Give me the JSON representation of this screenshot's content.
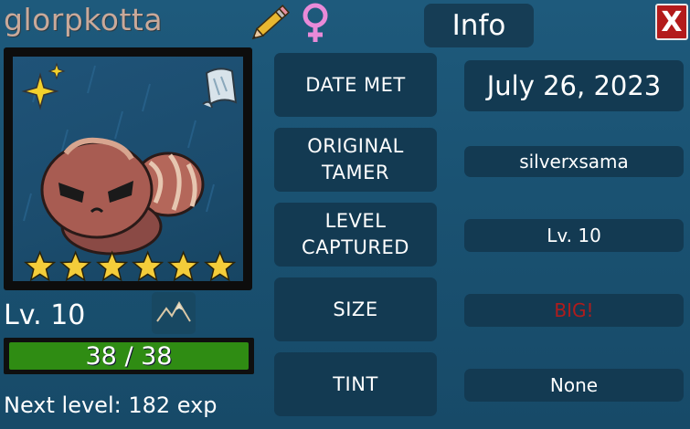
{
  "monster": {
    "name": "glorpkotta",
    "level": "Lv. 10",
    "hp_text": "38 / 38",
    "hp_fraction": 1.0,
    "next_level": "Next level: 182 exp",
    "stars": 6,
    "gender_icon": "female-icon"
  },
  "panel": {
    "title": "Info",
    "close_label": "X"
  },
  "info_rows": [
    {
      "label": "DATE MET",
      "value": "July 26, 2023"
    },
    {
      "label": "ORIGINAL TAMER",
      "value": "silverxsama"
    },
    {
      "label": "LEVEL CAPTURED",
      "value": "Lv. 10"
    },
    {
      "label": "SIZE",
      "value": "BIG!"
    },
    {
      "label": "TINT",
      "value": "None"
    }
  ],
  "colors": {
    "background": "#1a5272",
    "panel": "#133a52",
    "hp_fill": "#2f8c13",
    "close": "#b31b1b",
    "size_value": "#b01c1c",
    "star": "#f4cd3a",
    "name": "#c9a99a"
  }
}
